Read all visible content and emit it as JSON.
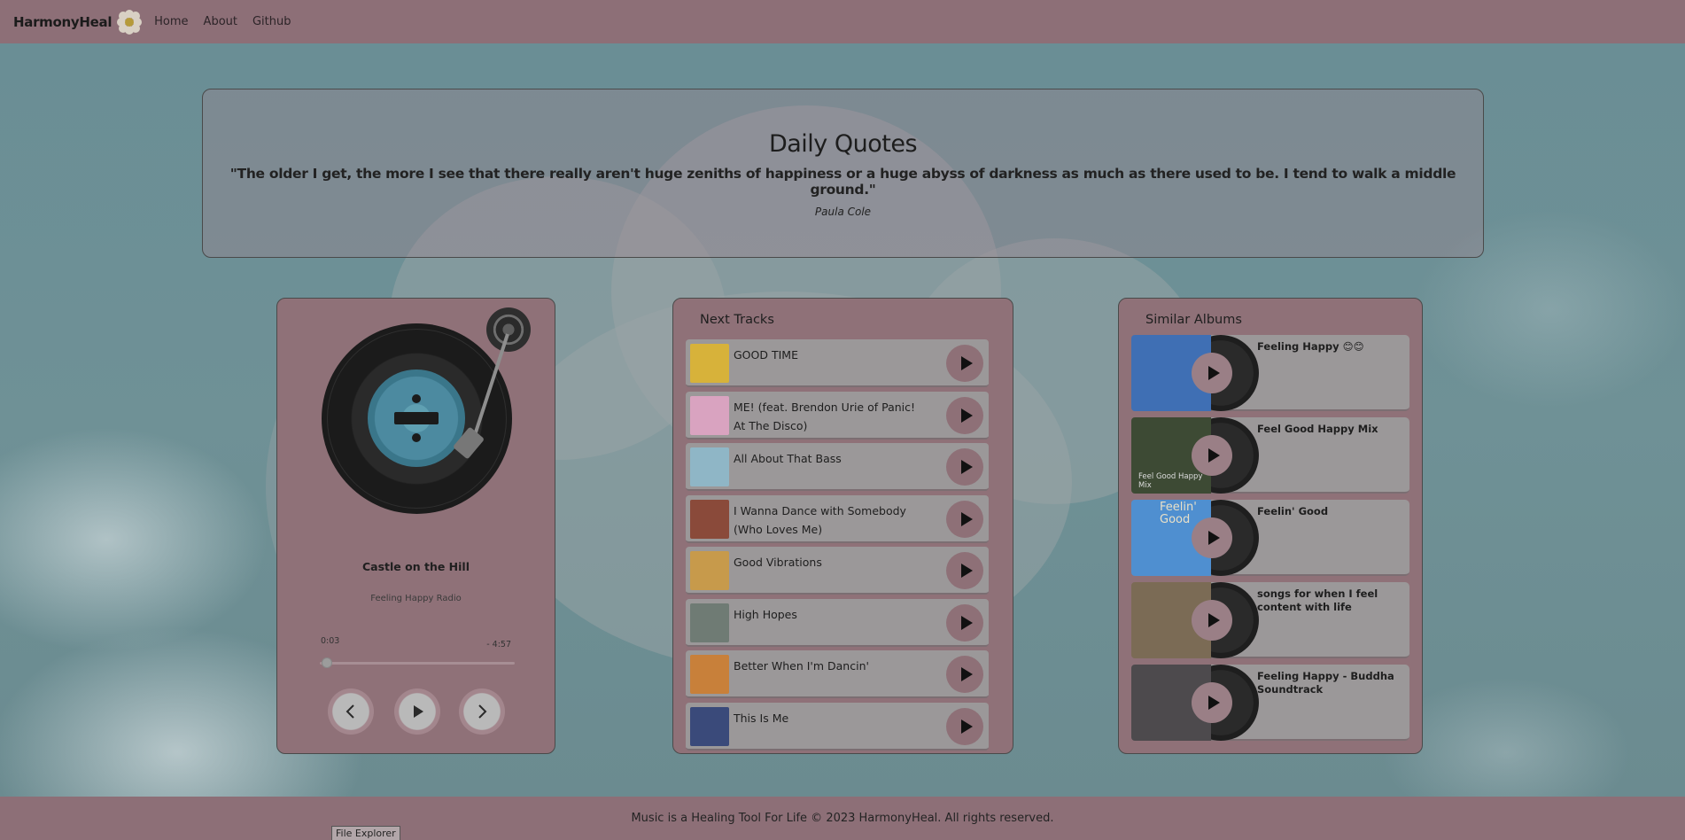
{
  "nav": {
    "brand": "HarmonyHeal",
    "links": [
      "Home",
      "About",
      "Github"
    ]
  },
  "quotes": {
    "title": "Daily Quotes",
    "text": "\"The older I get, the more I see that there really aren't huge zeniths of happiness or a huge abyss of darkness as much as there used to be. I tend to walk a middle ground.\"",
    "author": "Paula Cole"
  },
  "player": {
    "song": "Castle on the Hill",
    "source": "Feeling Happy Radio",
    "time_current": "0:03",
    "time_remaining": "- 4:57",
    "progress": 0.01
  },
  "tracks": {
    "title": "Next Tracks",
    "items": [
      {
        "name": "GOOD TIME",
        "color": "#d7b23a"
      },
      {
        "name": "ME! (feat. Brendon Urie of Panic! At The Disco)",
        "color": "#d9a3c0"
      },
      {
        "name": "All About That Bass",
        "color": "#8fb6c6"
      },
      {
        "name": "I Wanna Dance with Somebody (Who Loves Me)",
        "color": "#8a4a3a"
      },
      {
        "name": "Good Vibrations",
        "color": "#c79a4b"
      },
      {
        "name": "High Hopes",
        "color": "#6f7b74"
      },
      {
        "name": "Better When I'm Dancin'",
        "color": "#c8803a"
      },
      {
        "name": "This Is Me",
        "color": "#3a4a7a"
      }
    ]
  },
  "albums": {
    "title": "Similar Albums",
    "items": [
      {
        "name": "Feeling Happy 😊😊",
        "color": "#3f6fb4"
      },
      {
        "name": "Feel Good Happy Mix",
        "color": "#3d4a34",
        "cover_text": "Feel Good Happy Mix"
      },
      {
        "name": "Feelin' Good",
        "color": "#4f8fd0",
        "cover_text": "Feelin' Good"
      },
      {
        "name": "songs for when I feel content with life",
        "color": "#7b6b55"
      },
      {
        "name": "Feeling Happy - Buddha Soundtrack",
        "color": "#4d4a4d"
      }
    ]
  },
  "footer": {
    "text": "Music is a Healing Tool For Life © 2023 HarmonyHeal. All rights reserved.",
    "tooltip": "File Explorer"
  }
}
